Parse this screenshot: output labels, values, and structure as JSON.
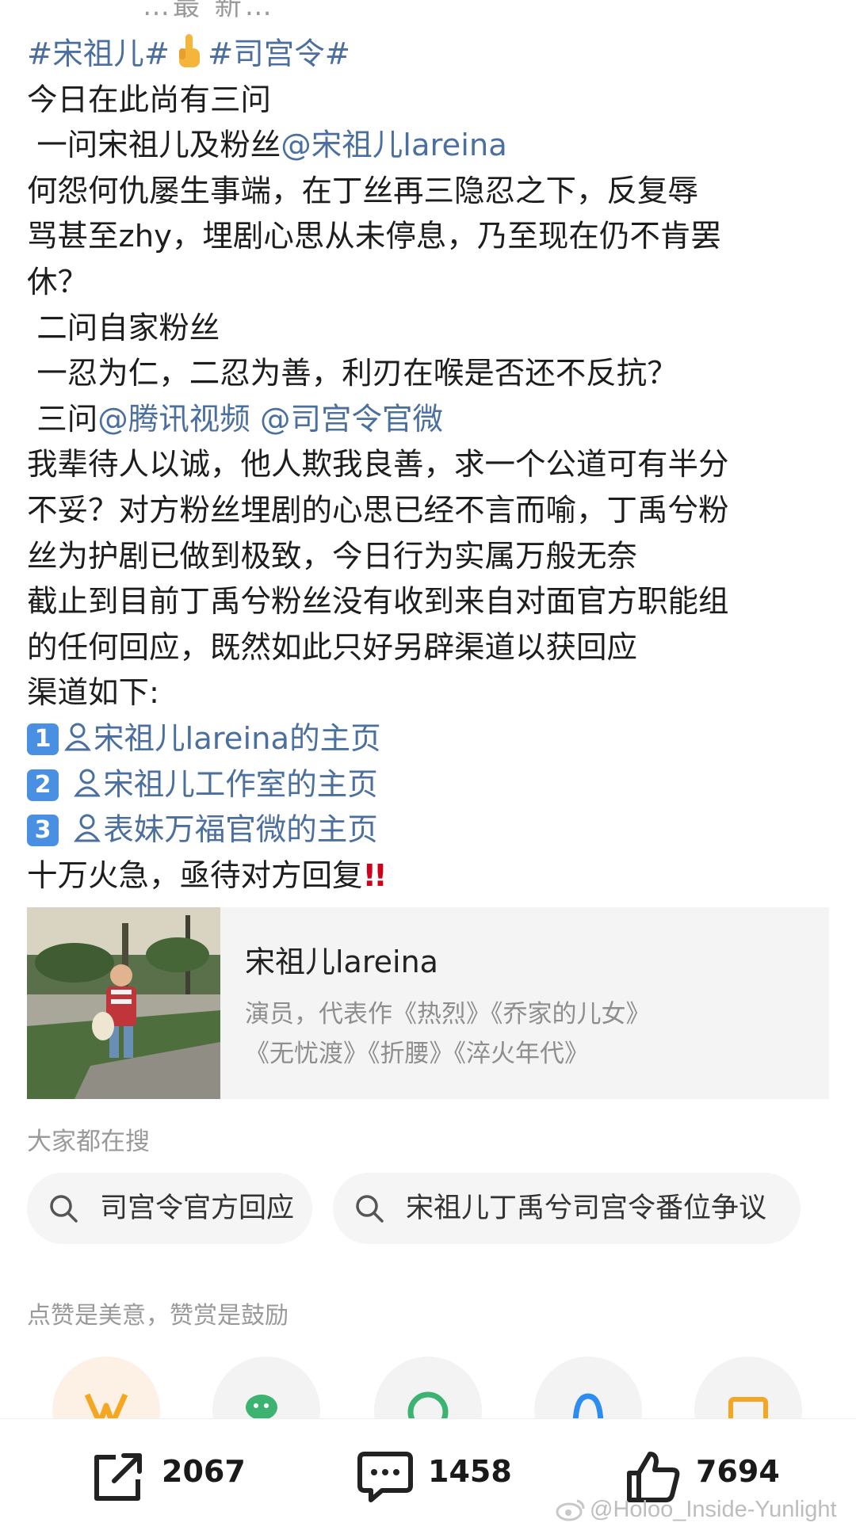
{
  "top_fragment": "…最 新…",
  "post": {
    "hashtags": [
      "#宋祖儿#",
      "#司宫令#"
    ],
    "line_1": "今日在此尚有三问",
    "q1_prefix": " 一问宋祖儿及粉丝",
    "q1_mention": "@宋祖儿lareina",
    "body_1": "何怨何仇屡生事端，在丁丝再三隐忍之下，反复辱",
    "body_2": "骂甚至zhy，埋剧心思从未停息，乃至现在仍不肯罢",
    "body_3": "休？",
    "q2": " 二问自家粉丝",
    "q2_body": " 一忍为仁，二忍为善，利刃在喉是否还不反抗？",
    "q3_prefix": " 三问",
    "q3_mention_1": "@腾讯视频",
    "q3_mention_2": "@司宫令官微",
    "body_4": "我辈待人以诚，他人欺我良善，求一个公道可有半分",
    "body_5": "不妥？对方粉丝埋剧的心思已经不言而喻，丁禹兮粉",
    "body_6": "丝为护剧已做到极致，今日行为实属万般无奈",
    "body_7": "截止到目前丁禹兮粉丝没有收到来自对面官方职能组",
    "body_8": "的任何回应，既然如此只好另辟渠道以获回应",
    "channels_label": "渠道如下:",
    "channels": [
      {
        "num": "1",
        "label": "宋祖儿lareina的主页"
      },
      {
        "num": "2",
        "label": "宋祖儿工作室的主页"
      },
      {
        "num": "3",
        "label": "表妹万福官微的主页"
      }
    ],
    "closing": "十万火急，亟待对方回复",
    "closing_mark": "!!"
  },
  "profile_card": {
    "name": "宋祖儿lareina",
    "desc_1": "演员，代表作《热烈》《乔家的儿女》",
    "desc_2": "《无忧渡》《折腰》《淬火年代》"
  },
  "search": {
    "label": "大家都在搜",
    "chips": [
      "司宫令官方回应",
      "宋祖儿丁禹兮司宫令番位争议"
    ]
  },
  "reward": {
    "label": "点赞是美意，赞赏是鼓励",
    "icons": [
      "reward-icon",
      "wechat-icon",
      "moments-icon",
      "qq-icon",
      "image-icon"
    ]
  },
  "actions": {
    "share_count": "2067",
    "comment_count": "1458",
    "like_count": "7694"
  },
  "watermark": "@Holoo_Inside-Yunlight",
  "colors": {
    "link": "#4b6f9e",
    "number_badge": "#4a90e2",
    "alert_red": "#d0021b"
  }
}
